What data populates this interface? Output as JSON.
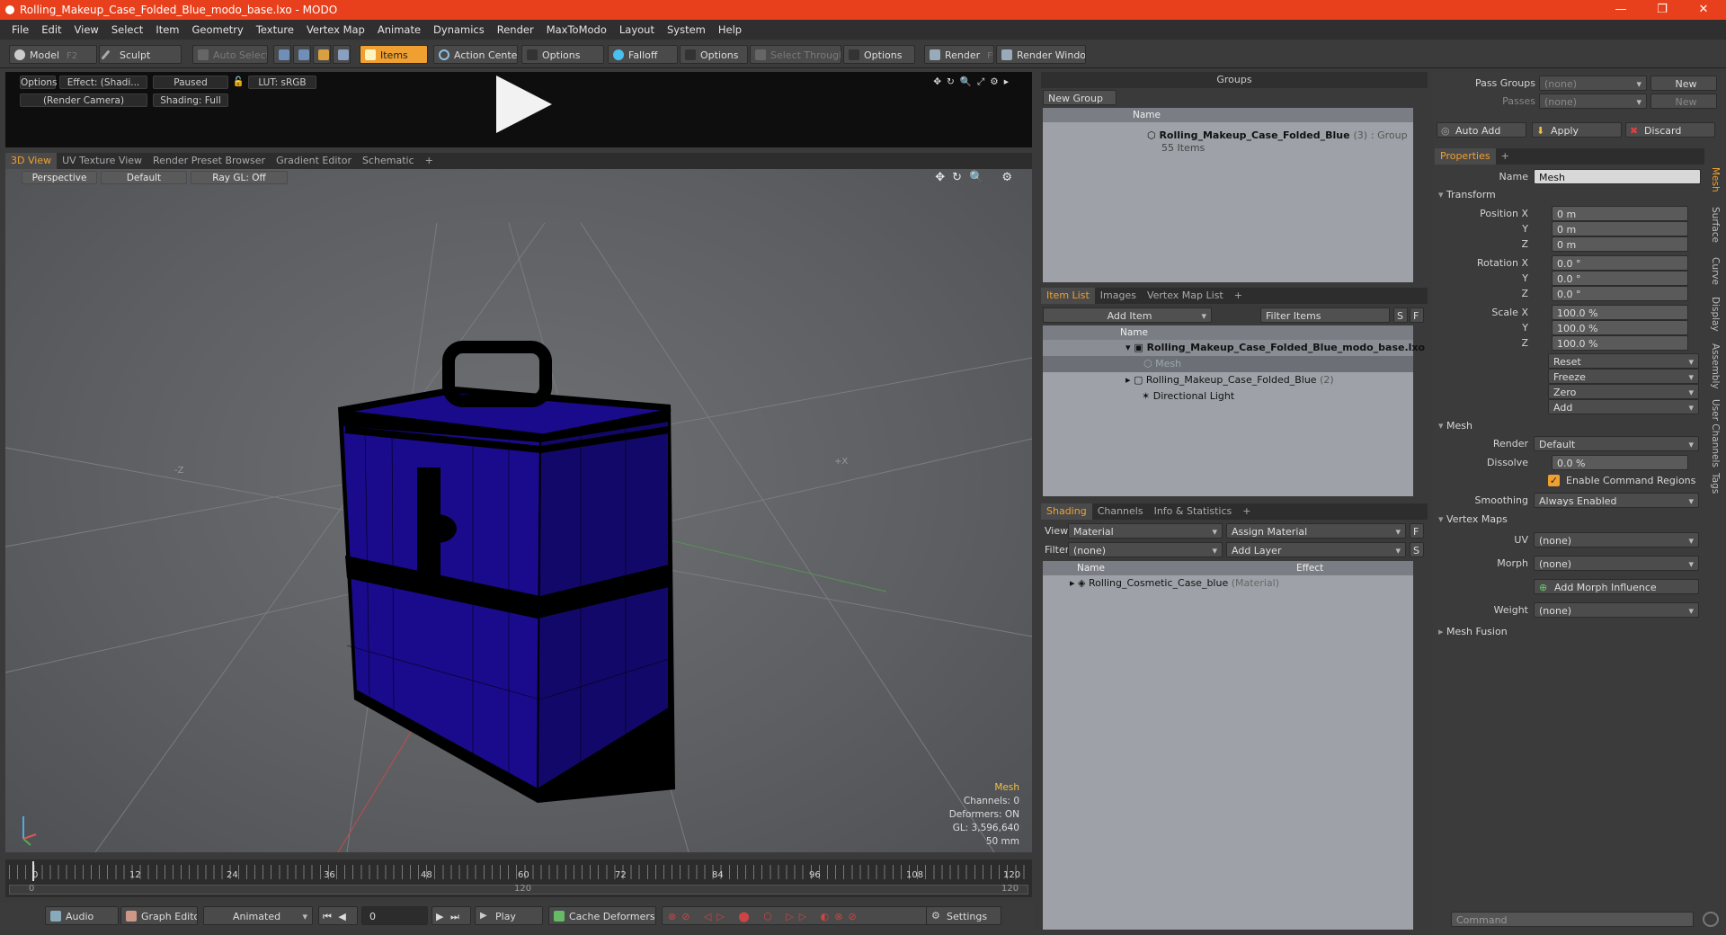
{
  "titlebar": {
    "title": "Rolling_Makeup_Case_Folded_Blue_modo_base.lxo - MODO",
    "minimize": "—",
    "maximize": "❐",
    "close": "✕"
  },
  "menu": [
    "File",
    "Edit",
    "View",
    "Select",
    "Item",
    "Geometry",
    "Texture",
    "Vertex Map",
    "Animate",
    "Dynamics",
    "Render",
    "MaxToModo",
    "Layout",
    "System",
    "Help"
  ],
  "toolbar": {
    "model": "Model",
    "model_key": "F2",
    "sculpt": "Sculpt",
    "auto_select": "Auto Select",
    "items": "Items",
    "action_center": "Action Center",
    "options1": "Options",
    "falloff": "Falloff",
    "options2": "Options",
    "select_through": "Select Through",
    "options3": "Options",
    "render": "Render",
    "render_key": "F9",
    "render_window": "Render Window"
  },
  "preview": {
    "options": "Options",
    "effect": "Effect: (Shadi...",
    "paused": "Paused",
    "lut": "LUT: sRGB",
    "camera": "(Render Camera)",
    "shading": "Shading: Full"
  },
  "viewport_tabs": [
    "3D View",
    "UV Texture View",
    "Render Preset Browser",
    "Gradient Editor",
    "Schematic",
    "+"
  ],
  "viewport": {
    "perspective": "Perspective",
    "default": "Default",
    "raygl": "Ray GL: Off",
    "axis_z": "-Z",
    "axis_x": "+X",
    "info": {
      "mesh": "Mesh",
      "channels": "Channels: 0",
      "deformers": "Deformers: ON",
      "gl": "GL: 3,596,640",
      "size": "50 mm"
    }
  },
  "timeline": {
    "ticks": [
      "0",
      "12",
      "24",
      "36",
      "48",
      "60",
      "72",
      "84",
      "96",
      "108",
      "120"
    ],
    "start": "0",
    "end": "120",
    "mid": "120"
  },
  "bottombar": {
    "audio": "Audio",
    "graph_editor": "Graph Editor",
    "animated": "Animated",
    "frame": "0",
    "play": "Play",
    "cache": "Cache Deformers",
    "settings": "Settings"
  },
  "groups": {
    "title": "Groups",
    "new_group": "New Group",
    "col_name": "Name",
    "item_name": "Rolling_Makeup_Case_Folded_Blue",
    "item_count": "(3)",
    "item_type": ": Group",
    "item_sub": "55 Items"
  },
  "itemlist": {
    "tabs": [
      "Item List",
      "Images",
      "Vertex Map List",
      "+"
    ],
    "add_item": "Add Item",
    "filter": "Filter Items",
    "s": "S",
    "f": "F",
    "col_name": "Name",
    "rows": [
      {
        "label": "Rolling_Makeup_Case_Folded_Blue_modo_base.lxo",
        "extra": ""
      },
      {
        "label": "Mesh",
        "extra": ""
      },
      {
        "label": "Rolling_Makeup_Case_Folded_Blue",
        "extra": "(2)"
      },
      {
        "label": "Directional Light",
        "extra": ""
      }
    ]
  },
  "shading": {
    "tabs": [
      "Shading",
      "Channels",
      "Info & Statistics",
      "+"
    ],
    "view_label": "View",
    "view_value": "Material",
    "assign": "Assign Material",
    "f": "F",
    "filter_label": "Filter",
    "filter_value": "(none)",
    "add_layer": "Add Layer",
    "s": "S",
    "col_name": "Name",
    "col_effect": "Effect",
    "row_name": "Rolling_Cosmetic_Case_blue",
    "row_type": "(Material)"
  },
  "right": {
    "pass_groups": "Pass Groups",
    "pass_groups_val": "(none)",
    "new": "New",
    "passes": "Passes",
    "passes_val": "(none)",
    "new2": "New",
    "auto_add": "Auto Add",
    "apply": "Apply",
    "discard": "Discard",
    "properties_tab": "Properties",
    "plus": "+",
    "name_label": "Name",
    "name_value": "Mesh",
    "transform": "Transform",
    "position_x": "Position X",
    "pos_x": "0 m",
    "y": "Y",
    "pos_y": "0 m",
    "z": "Z",
    "pos_z": "0 m",
    "rotation_x": "Rotation X",
    "rot_x": "0.0 °",
    "rot_y": "0.0 °",
    "rot_z": "0.0 °",
    "scale_x": "Scale X",
    "sc_x": "100.0 %",
    "sc_y": "100.0 %",
    "sc_z": "100.0 %",
    "reset": "Reset",
    "freeze": "Freeze",
    "zero": "Zero",
    "add": "Add",
    "mesh": "Mesh",
    "render_label": "Render",
    "render_val": "Default",
    "dissolve_label": "Dissolve",
    "dissolve_val": "0.0 %",
    "enable_cmd": "Enable Command Regions",
    "smoothing_label": "Smoothing",
    "smoothing_val": "Always Enabled",
    "vertex_maps": "Vertex Maps",
    "uv_label": "UV",
    "uv_val": "(none)",
    "morph_label": "Morph",
    "morph_val": "(none)",
    "add_morph": "Add Morph Influence",
    "weight_label": "Weight",
    "weight_val": "(none)",
    "mesh_fusion": "Mesh Fusion",
    "command_placeholder": "Command",
    "vtabs": [
      "Mesh",
      "Surface",
      "Curve",
      "Display",
      "Assembly",
      "User Channels",
      "Tags"
    ]
  },
  "colors": {
    "accent": "#f0a030",
    "title": "#e8401c",
    "mesh_blue": "#1a0a8c"
  }
}
